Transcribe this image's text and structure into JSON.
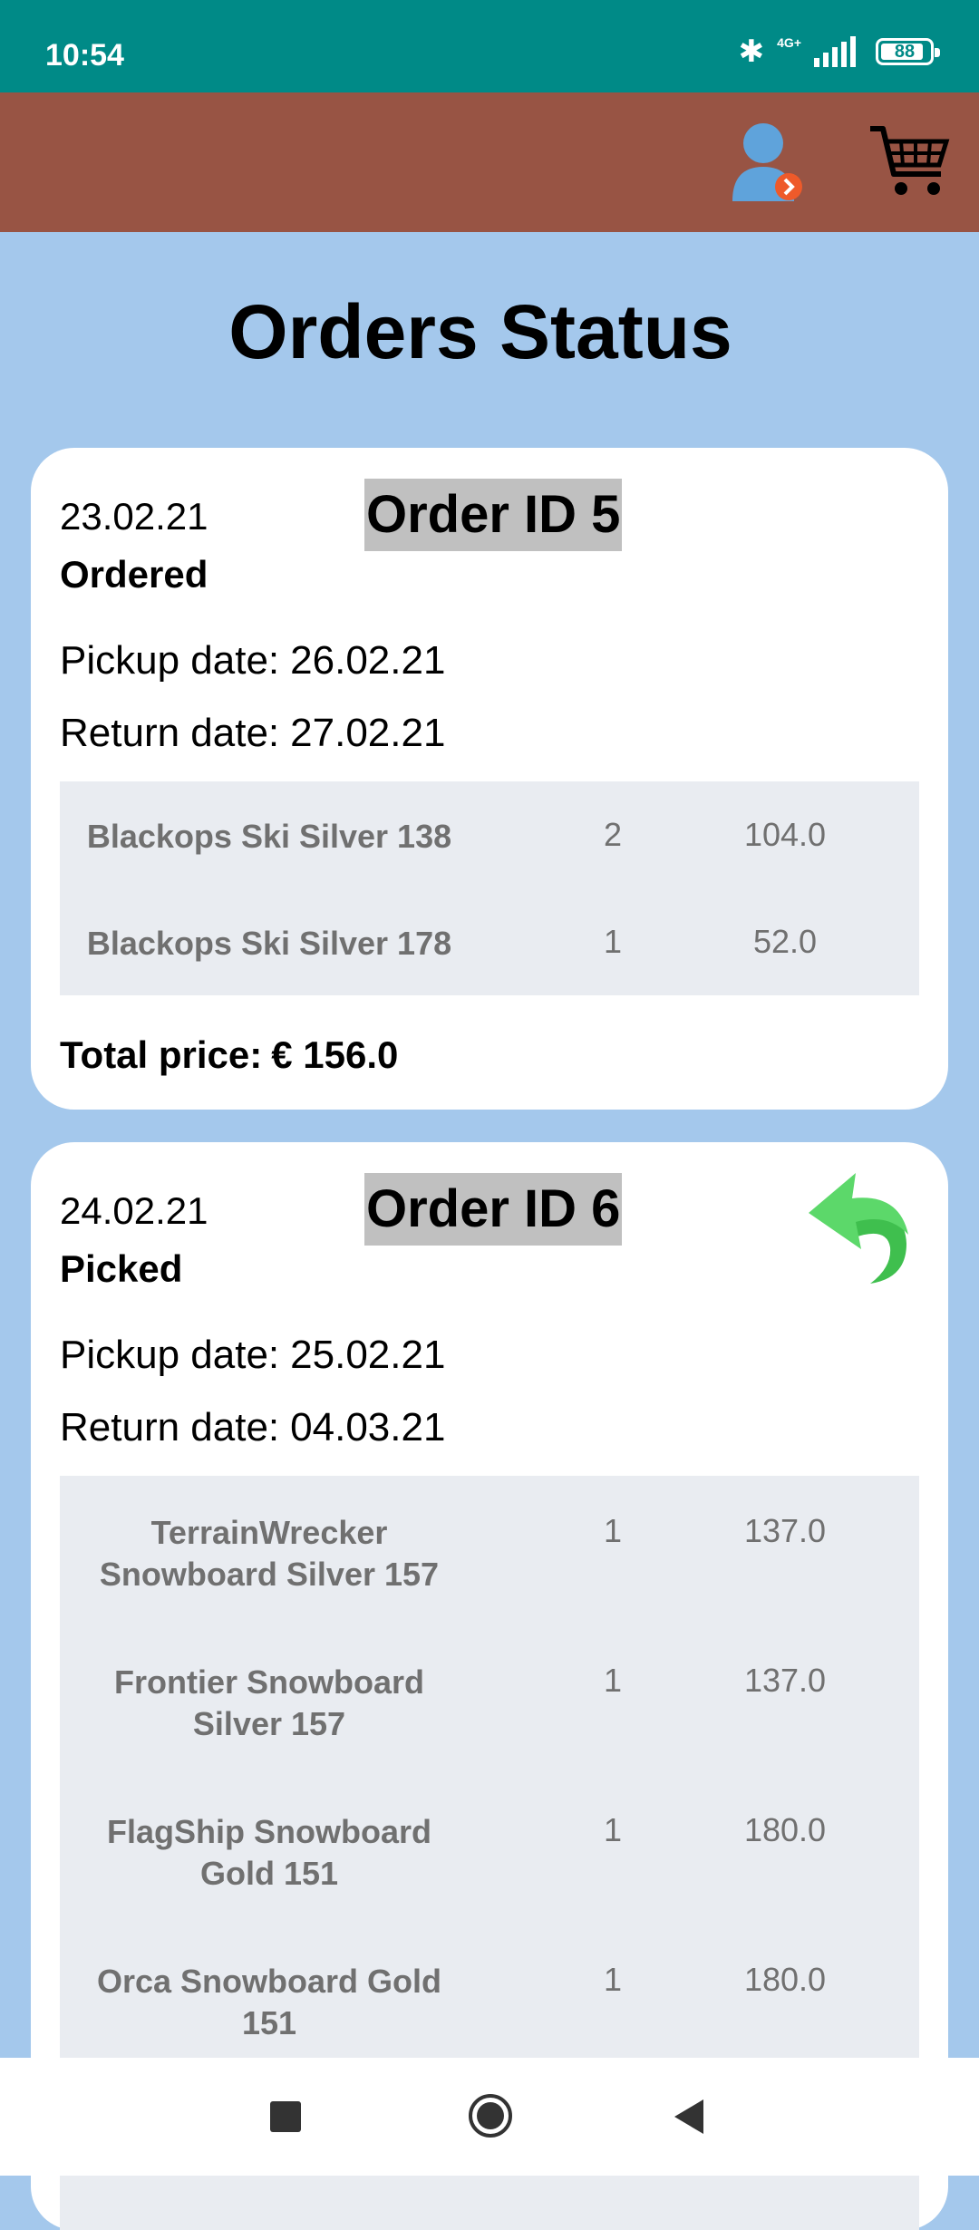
{
  "status_bar": {
    "time": "10:54",
    "network": "4G+",
    "battery": "88",
    "battery_level": 0.88
  },
  "app_bar": {
    "profile_icon": "user-profile-icon",
    "cart_icon": "shopping-cart-icon"
  },
  "page": {
    "title": "Orders Status"
  },
  "orders": [
    {
      "date": "23.02.21",
      "order_id": "Order ID 5",
      "status": "Ordered",
      "pickup_label": "Pickup date:",
      "pickup_date": "26.02.21",
      "return_label": "Return date:",
      "return_date": "27.02.21",
      "items": [
        {
          "name": "Blackops Ski Silver 138",
          "qty": "2",
          "price": "104.0"
        },
        {
          "name": "Blackops Ski Silver 178",
          "qty": "1",
          "price": "52.0"
        }
      ],
      "total_label": "Total price:",
      "total_value": "€ 156.0"
    },
    {
      "date": "24.02.21",
      "order_id": "Order ID 6",
      "status": "Picked",
      "pickup_label": "Pickup date:",
      "pickup_date": "25.02.21",
      "return_label": "Return date:",
      "return_date": "04.03.21",
      "action_icon": "return-arrow-icon",
      "items": [
        {
          "name": "TerrainWrecker Snowboard Silver 157",
          "qty": "1",
          "price": "137.0"
        },
        {
          "name": "Frontier Snowboard Silver 157",
          "qty": "1",
          "price": "137.0"
        },
        {
          "name": "FlagShip Snowboard Gold 151",
          "qty": "1",
          "price": "180.0"
        },
        {
          "name": "Orca Snowboard Gold 151",
          "qty": "1",
          "price": "180.0"
        }
      ]
    }
  ],
  "colors": {
    "status_bar": "#008a87",
    "app_bar": "#985444",
    "background": "#a4c8ec",
    "card": "#ffffff",
    "table": "#e9ecf1",
    "order_id_highlight": "#c0c0c0",
    "return_icon": "#4cd45a"
  },
  "nav_bar": {
    "icons": [
      "recents-square-icon",
      "home-circle-icon",
      "back-triangle-icon"
    ]
  }
}
